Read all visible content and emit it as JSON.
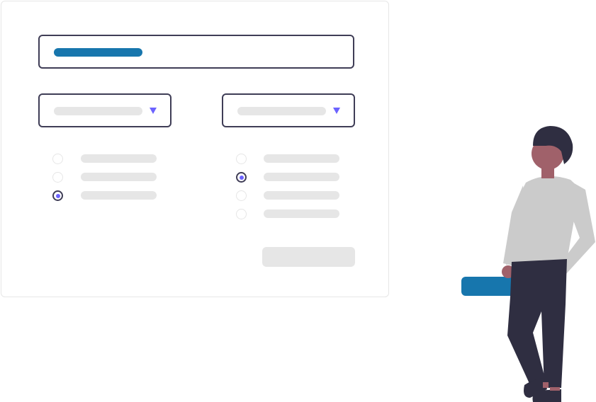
{
  "form": {
    "text_field": {
      "accent_color": "#1776ad"
    },
    "dropdowns": [
      {
        "caret_icon": "caret-down-icon",
        "caret_color": "#6c63ff"
      },
      {
        "caret_icon": "caret-down-icon",
        "caret_color": "#6c63ff"
      }
    ],
    "radio_groups": [
      {
        "options": 3,
        "selected_index": 2
      },
      {
        "options": 4,
        "selected_index": 1
      }
    ],
    "submit_button": {
      "state": "disabled"
    }
  },
  "illustration": {
    "subject": "person-standing",
    "held_object_color": "#1776ad",
    "outline_color": "#3f3d56"
  }
}
